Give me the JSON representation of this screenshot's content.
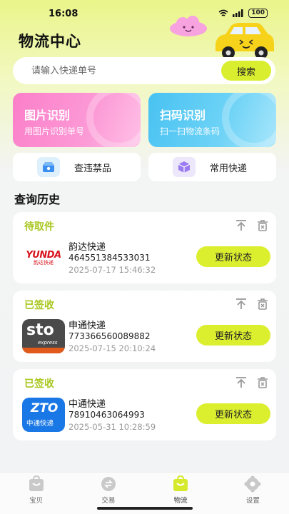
{
  "status_bar": {
    "time": "16:08",
    "battery": "100"
  },
  "header": {
    "title": "物流中心"
  },
  "search": {
    "placeholder": "请输入快递单号",
    "button_label": "搜索"
  },
  "features": [
    {
      "title": "图片识别",
      "subtitle": "用图片识别单号",
      "color": "#fb7fc9"
    },
    {
      "title": "扫码识别",
      "subtitle": "扫一扫物流条码",
      "color": "#48c2f2"
    }
  ],
  "quick_links": [
    {
      "label": "查违禁品",
      "icon": "box-search-icon"
    },
    {
      "label": "常用快递",
      "icon": "package-icon"
    }
  ],
  "history": {
    "title": "查询历史",
    "items": [
      {
        "status": "待取件",
        "company": "韵达快递",
        "logo_text": "YUNDA",
        "logo_sub": "韵达快递",
        "tracking_number": "464551384533031",
        "datetime": "2025-07-17 15:46:32",
        "button_label": "更新状态"
      },
      {
        "status": "已签收",
        "company": "申通快递",
        "logo_text": "sto",
        "logo_sub": "express",
        "tracking_number": "773366560089882",
        "datetime": "2025-07-15 20:10:24",
        "button_label": "更新状态"
      },
      {
        "status": "已签收",
        "company": "中通快递",
        "logo_text": "ZTO",
        "logo_sub": "中通快递",
        "tracking_number": "78910463064993",
        "datetime": "2025-05-31 10:28:59",
        "button_label": "更新状态"
      }
    ]
  },
  "tabs": [
    {
      "label": "宝贝",
      "icon": "bag-icon",
      "active": false
    },
    {
      "label": "交易",
      "icon": "trade-icon",
      "active": false
    },
    {
      "label": "物流",
      "icon": "logistics-icon",
      "active": true
    },
    {
      "label": "设置",
      "icon": "settings-icon",
      "active": false
    }
  ],
  "colors": {
    "accent": "#dcef2f",
    "status_text": "#a8c720",
    "brand_yunda": "#d8141e",
    "brand_zto": "#1a78e6"
  }
}
